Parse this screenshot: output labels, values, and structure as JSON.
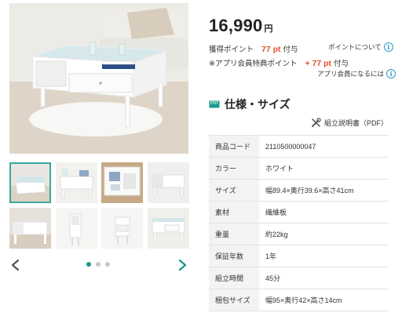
{
  "gallery": {
    "thumbnail_count": 8,
    "active_index": 0,
    "dots": 3,
    "active_dot": 0,
    "accent_color": "#1a9a8c"
  },
  "product": {
    "price": "16,990",
    "price_unit": "円",
    "points": {
      "earned_label": "獲得ポイント",
      "earned_value": "77 pt",
      "earned_suffix": "付与",
      "earned_link": "ポイントについて",
      "member_label": "※アプリ会員特典ポイント",
      "member_value": "+ 77 pt",
      "member_suffix": "付与",
      "member_link": "アプリ会員になるには"
    }
  },
  "spec": {
    "heading": "仕様・サイズ",
    "manual_link": "組立説明書（PDF）",
    "rows": [
      {
        "key": "商品コード",
        "value": "2110500000047"
      },
      {
        "key": "カラー",
        "value": "ホワイト"
      },
      {
        "key": "サイズ",
        "value": "幅89.4×奥行39.6×高さ41cm"
      },
      {
        "key": "素材",
        "value": "繊維板"
      },
      {
        "key": "重量",
        "value": "約22kg"
      },
      {
        "key": "保証年数",
        "value": "1年"
      },
      {
        "key": "組立時間",
        "value": "45分"
      },
      {
        "key": "梱包サイズ",
        "value": "幅95×奥行42×高さ14cm"
      }
    ]
  },
  "colors": {
    "point_accent": "#e0532d",
    "info_icon": "#2d9ac6",
    "heading_icon": "#1a9a8c"
  },
  "icons": {
    "prev": "chevron-left-icon",
    "next": "chevron-right-icon",
    "info": "info-icon",
    "spec": "ruler-icon",
    "manual": "tools-icon"
  }
}
